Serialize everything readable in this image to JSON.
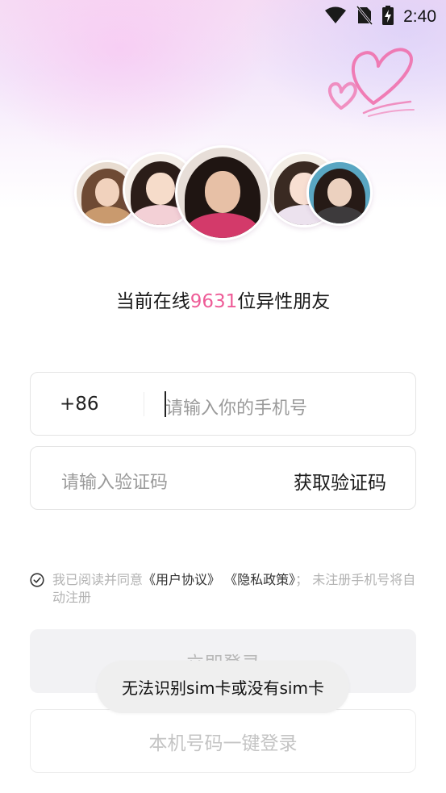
{
  "status_bar": {
    "time": "2:40",
    "icons": [
      "wifi-icon",
      "no-sim-icon",
      "battery-charging-icon"
    ]
  },
  "decoration": {
    "icon": "hearts-icon",
    "color": "#f06aa8"
  },
  "avatars": [
    "avatar-1",
    "avatar-2",
    "avatar-3",
    "avatar-4",
    "avatar-5"
  ],
  "online": {
    "prefix": "当前在线",
    "count": "9631",
    "suffix": "位异性朋友",
    "count_color": "#ee5c97"
  },
  "phone": {
    "country_code": "+86",
    "placeholder": "请输入你的手机号"
  },
  "code": {
    "placeholder": "请输入验证码",
    "get_code_label": "获取验证码"
  },
  "agreement": {
    "prefix": "我已阅读并同意",
    "user_agreement": "《用户协议》",
    "privacy_policy": "《隐私政策》",
    "suffix": "；  未注册手机号将自动注册"
  },
  "login_button": "立即登录",
  "onekey_button": "本机号码一键登录",
  "toast": "无法识别sim卡或没有sim卡"
}
